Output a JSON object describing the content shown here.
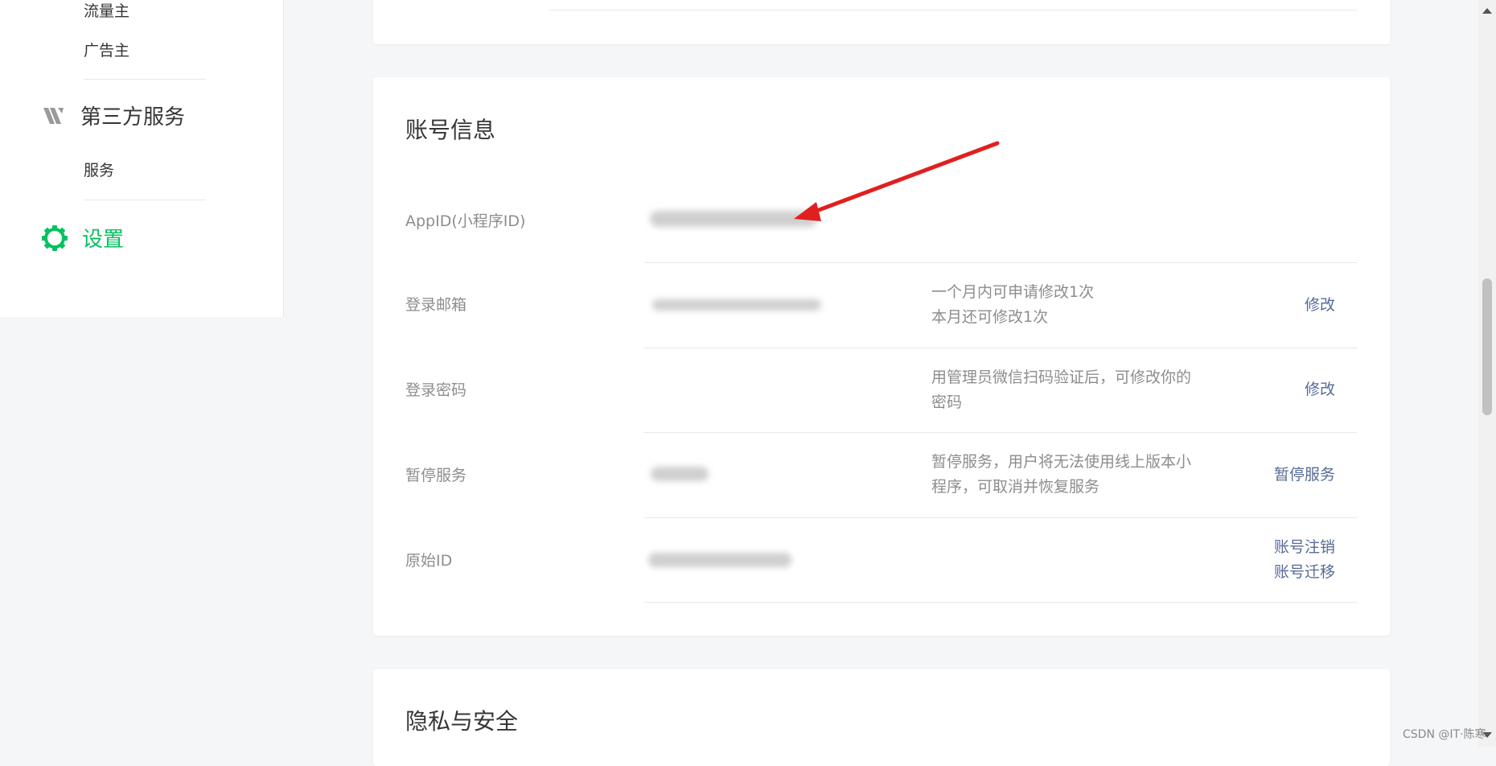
{
  "sidebar": {
    "sub_items_top": [
      "流量主",
      "广告主"
    ],
    "third_party": {
      "label": "第三方服务",
      "icon": "third-party-services-icon"
    },
    "service_item": "服务",
    "settings": {
      "label": "设置",
      "icon": "gear-icon",
      "color": "#07c160"
    }
  },
  "account_card": {
    "title": "账号信息",
    "rows": [
      {
        "label": "AppID(小程序ID)",
        "desc": "",
        "action": "",
        "value_hidden": true
      },
      {
        "label": "登录邮箱",
        "desc": "一个月内可申请修改1次\n本月还可修改1次",
        "action": "修改",
        "value_hidden": true
      },
      {
        "label": "登录密码",
        "desc": "用管理员微信扫码验证后，可修改你的密码",
        "action": "修改",
        "value_hidden": false
      },
      {
        "label": "暂停服务",
        "desc": "暂停服务，用户将无法使用线上版本小程序，可取消并恢复服务",
        "action": "暂停服务",
        "value_hidden": true
      },
      {
        "label": "原始ID",
        "desc": "",
        "actions": [
          "账号注销",
          "账号迁移"
        ],
        "value_hidden": true
      }
    ]
  },
  "privacy_card": {
    "title": "隐私与安全"
  },
  "watermark": "CSDN @IT·陈寒",
  "colors": {
    "accent_green": "#07c160",
    "link_blue": "#576b95",
    "arrow_red": "#e02020"
  }
}
